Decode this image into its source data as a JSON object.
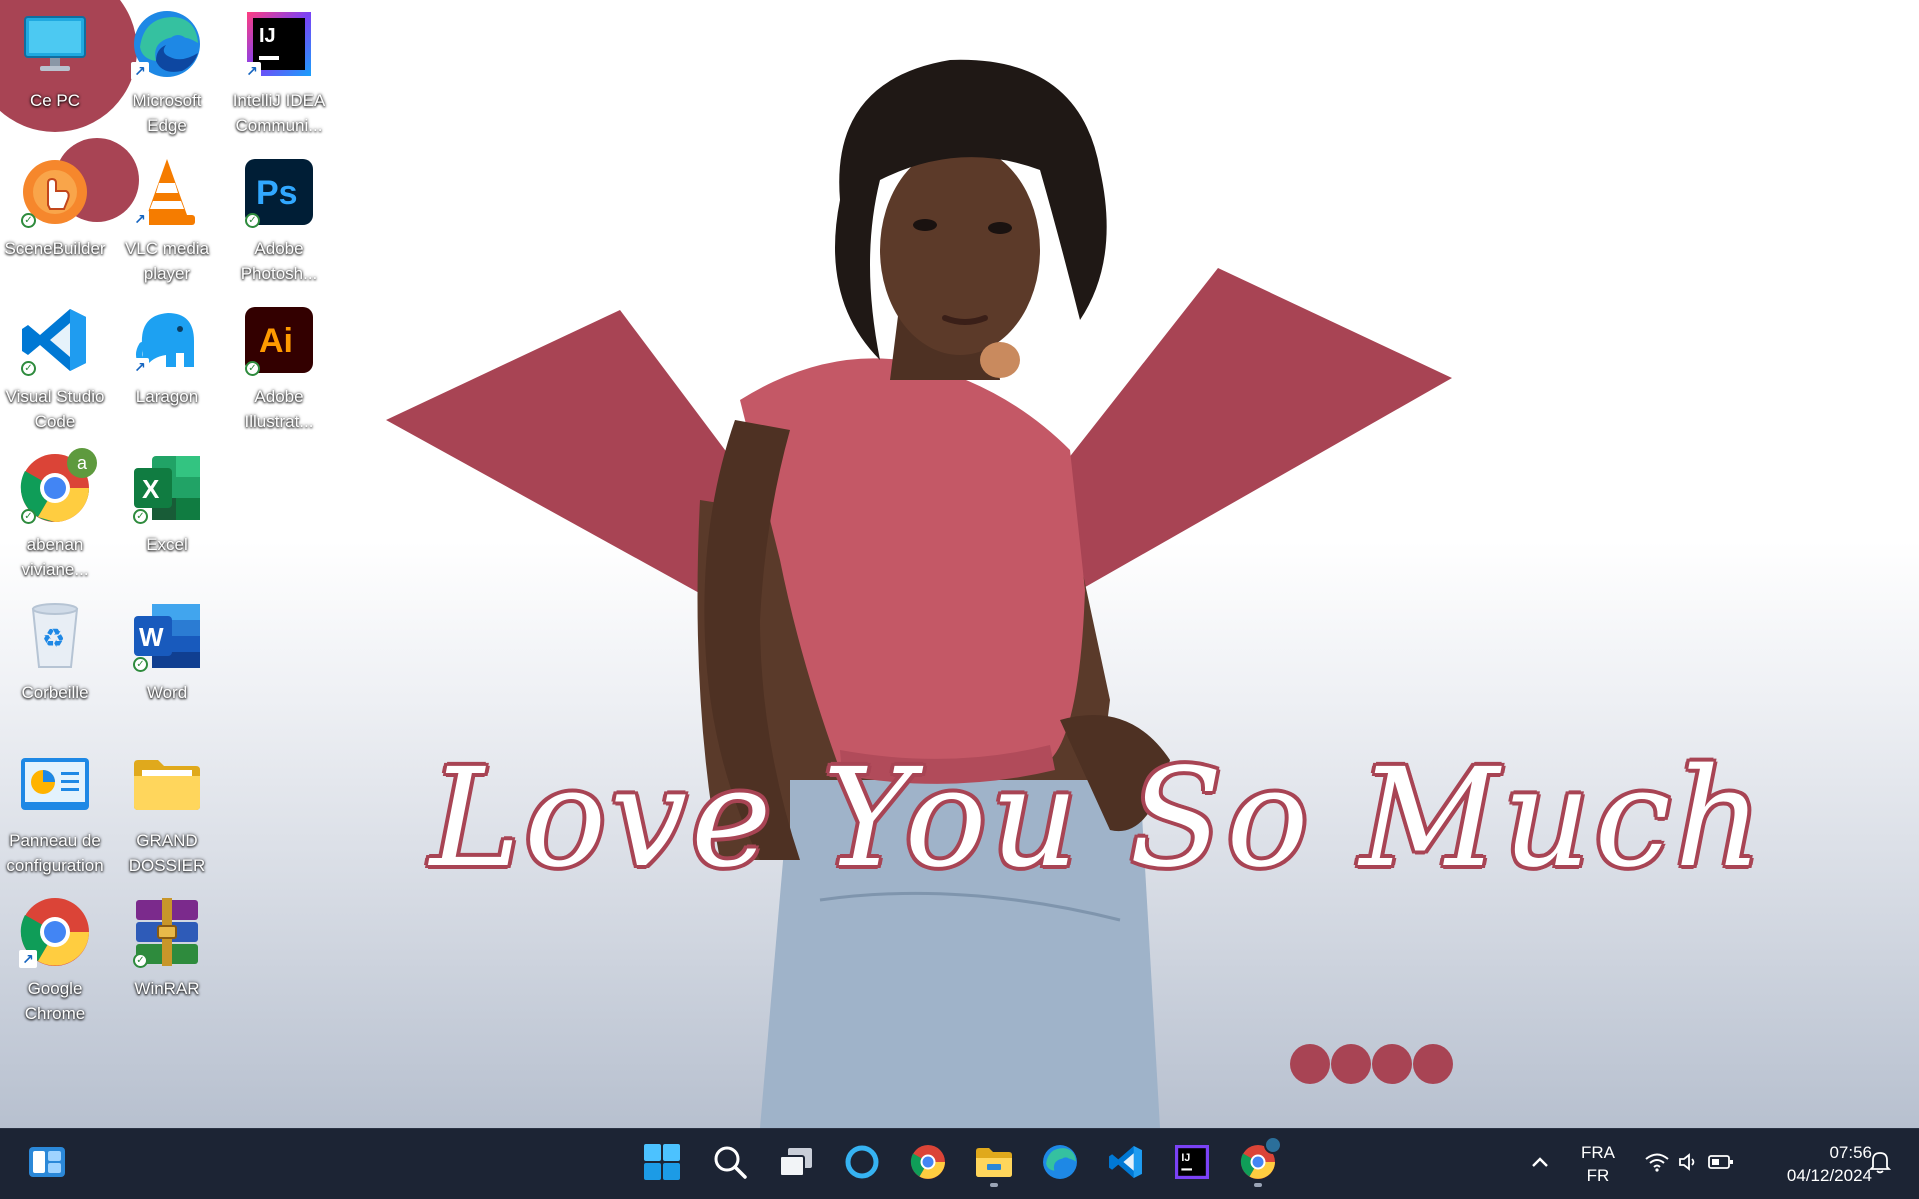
{
  "wallpaper": {
    "caption": "Love You So Much",
    "accent_color": "#a84454"
  },
  "desktop": {
    "icons": [
      {
        "label": "Ce PC",
        "icon": "monitor-icon"
      },
      {
        "label": "Microsoft Edge",
        "icon": "edge-icon"
      },
      {
        "label": "IntelliJ IDEA Communi...",
        "icon": "intellij-icon"
      },
      {
        "label": "SceneBuilder",
        "icon": "scenebuilder-icon"
      },
      {
        "label": "VLC media player",
        "icon": "vlc-icon"
      },
      {
        "label": "Adobe Photosh...",
        "icon": "photoshop-icon"
      },
      {
        "label": "Visual Studio Code",
        "icon": "vscode-icon"
      },
      {
        "label": "Laragon",
        "icon": "laragon-icon"
      },
      {
        "label": "Adobe Illustrat...",
        "icon": "illustrator-icon"
      },
      {
        "label": "abenan viviane...",
        "icon": "chrome-profile-icon"
      },
      {
        "label": "Excel",
        "icon": "excel-icon"
      },
      {
        "label": "Corbeille",
        "icon": "recycle-bin-icon"
      },
      {
        "label": "Word",
        "icon": "word-icon"
      },
      {
        "label": "Panneau de configuration",
        "icon": "control-panel-icon"
      },
      {
        "label": "GRAND DOSSIER",
        "icon": "folder-icon"
      },
      {
        "label": "Google Chrome",
        "icon": "chrome-icon"
      },
      {
        "label": "WinRAR",
        "icon": "winrar-icon"
      }
    ],
    "profile_badge_letter": "a"
  },
  "taskbar": {
    "apps": [
      "widgets-icon",
      "start-icon",
      "search-icon",
      "task-view-icon",
      "cortana-icon",
      "chrome-icon",
      "file-explorer-icon",
      "edge-icon",
      "vscode-icon",
      "intellij-icon",
      "chrome-profile-icon"
    ],
    "language_top": "FRA",
    "language_bottom": "FR",
    "time": "07:56",
    "date": "04/12/2024"
  }
}
